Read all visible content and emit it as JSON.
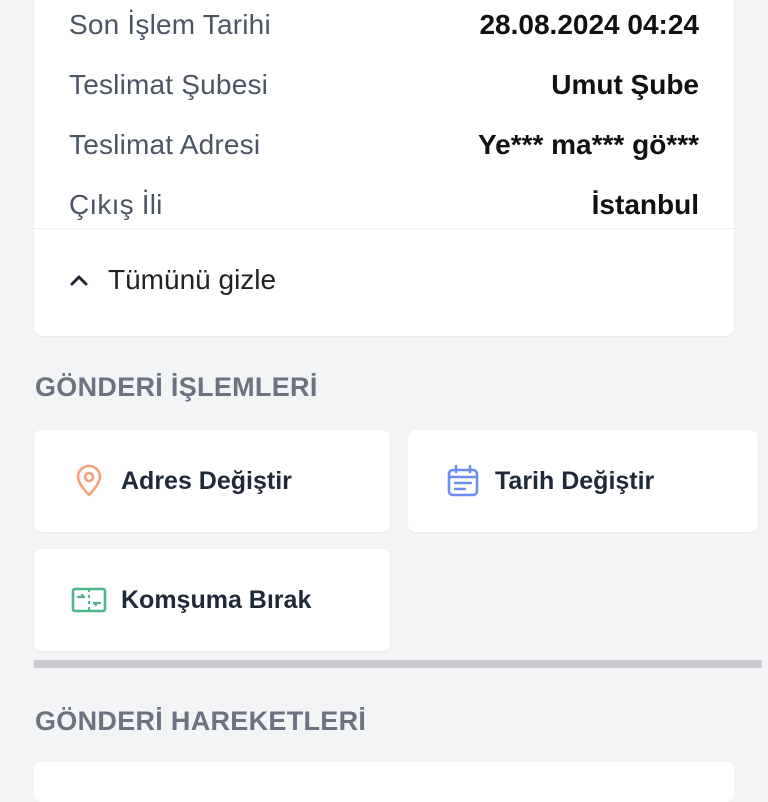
{
  "details": {
    "rows": [
      {
        "label": "Son İşlem Tarihi",
        "value": "28.08.2024 04:24"
      },
      {
        "label": "Teslimat Şubesi",
        "value": "Umut Şube"
      },
      {
        "label": "Teslimat Adresi",
        "value": "Ye*** ma*** gö***"
      },
      {
        "label": "Çıkış İli",
        "value": "İstanbul"
      }
    ],
    "toggle_label": "Tümünü gizle"
  },
  "actions_section": {
    "title": "GÖNDERİ İŞLEMLERİ",
    "items": [
      {
        "label": "Adres Değiştir",
        "icon": "location-pin-icon",
        "color": "#f4a27a"
      },
      {
        "label": "Tarih Değiştir",
        "icon": "calendar-icon",
        "color": "#6b8ef0"
      },
      {
        "label": "Komşuma Bırak",
        "icon": "neighbor-transfer-icon",
        "color": "#4fb58a"
      }
    ]
  },
  "movements_section": {
    "title": "GÖNDERİ HAREKETLERİ"
  }
}
